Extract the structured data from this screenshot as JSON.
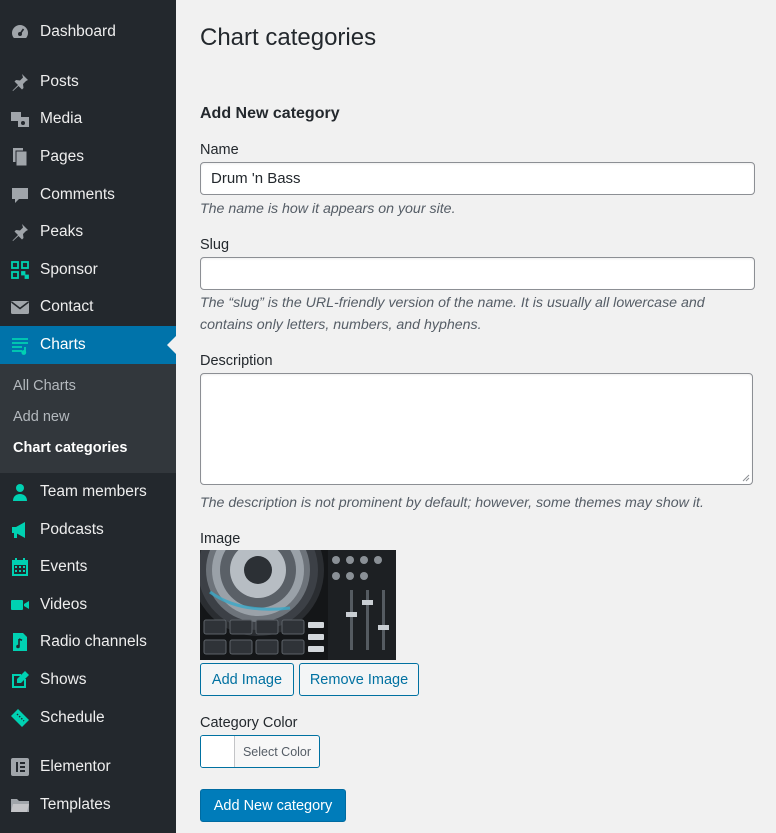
{
  "sidebar": {
    "items": [
      {
        "label": "Dashboard",
        "icon": "dashboard-icon"
      },
      {
        "label": "Posts",
        "icon": "pin-icon"
      },
      {
        "label": "Media",
        "icon": "media-icon"
      },
      {
        "label": "Pages",
        "icon": "pages-icon"
      },
      {
        "label": "Comments",
        "icon": "comment-icon"
      },
      {
        "label": "Peaks",
        "icon": "pin-icon"
      },
      {
        "label": "Sponsor",
        "icon": "qr-icon"
      },
      {
        "label": "Contact",
        "icon": "envelope-icon"
      },
      {
        "label": "Charts",
        "icon": "playlist-icon"
      },
      {
        "label": "Team members",
        "icon": "person-icon"
      },
      {
        "label": "Podcasts",
        "icon": "megaphone-icon"
      },
      {
        "label": "Events",
        "icon": "calendar-icon"
      },
      {
        "label": "Videos",
        "icon": "video-camera-icon"
      },
      {
        "label": "Radio channels",
        "icon": "music-file-icon"
      },
      {
        "label": "Shows",
        "icon": "edit-icon"
      },
      {
        "label": "Schedule",
        "icon": "ticket-icon"
      },
      {
        "label": "Elementor",
        "icon": "elementor-icon"
      },
      {
        "label": "Templates",
        "icon": "folder-icon"
      }
    ],
    "submenu": [
      "All Charts",
      "Add new",
      "Chart categories"
    ]
  },
  "page": {
    "title": "Chart categories",
    "form_title": "Add New category"
  },
  "form": {
    "name_label": "Name",
    "name_value": "Drum 'n Bass",
    "name_help": "The name is how it appears on your site.",
    "slug_label": "Slug",
    "slug_value": "",
    "slug_help_1": "The “slug” is the URL-friendly version of the name. It is usually all lowercase and",
    "slug_help_2": "contains only letters, numbers, and hyphens.",
    "description_label": "Description",
    "description_value": "",
    "description_help": "The description is not prominent by default; however, some themes may show it.",
    "image_label": "Image",
    "add_image": "Add Image",
    "remove_image": "Remove Image",
    "color_label": "Category Color",
    "select_color": "Select Color",
    "submit": "Add New category"
  },
  "colors": {
    "sidebar_bg": "#23282d",
    "submenu_bg": "#32373c",
    "accent": "#0073aa",
    "icon_teal": "#00d1b2",
    "icon_gray": "#a0a5aa"
  }
}
